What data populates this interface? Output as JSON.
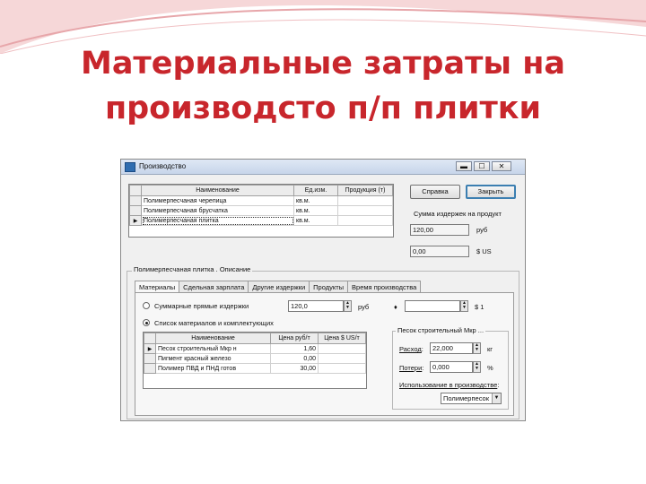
{
  "slide": {
    "title_line1": "Материальные затраты на",
    "title_line2": "производсто п/п плитки",
    "accent": "#c8262c"
  },
  "window": {
    "title": "Производство",
    "controls": {
      "minimize": "▬",
      "maximize": "☐",
      "close": "✕"
    }
  },
  "products_grid": {
    "columns": [
      "Наименование",
      "Ед.изм.",
      "Продукция (т)"
    ],
    "rows": [
      {
        "indicator": "",
        "name": "Полимерпесчаная черепица",
        "unit": "кв.м.",
        "qty": ""
      },
      {
        "indicator": "",
        "name": "Полимерпесчаная брусчатка",
        "unit": "кв.м.",
        "qty": ""
      },
      {
        "indicator": "▶",
        "name": "Полимерпесчаная плитка",
        "unit": "кв.м.",
        "qty": ""
      }
    ]
  },
  "right_panel": {
    "help_button": "Справка",
    "close_button": "Закрыть",
    "total_cost_label": "Сумма издержек на продукт",
    "cost_rub": "120,00",
    "rub_unit": "руб",
    "cost_usd": "0,00",
    "usd_unit": "$ US"
  },
  "details_group": {
    "title": "Полимерпесчаная плитка . Описание",
    "tabs": [
      "Материалы",
      "Сдельная зарплата",
      "Другие издержки",
      "Продукты",
      "Время производства"
    ],
    "active_tab": 0
  },
  "materials_tab": {
    "radio_total": "Суммарные прямые издержки",
    "total_value": "120,0",
    "total_unit": "руб",
    "usd_value": "",
    "usd_unit": "$ 1",
    "radio_list": "Список материалов и комплектующих",
    "grid": {
      "columns": [
        "Наименование",
        "Цена руб/т",
        "Цена $ US/т"
      ],
      "rows": [
        {
          "indicator": "▶",
          "name": "Песок строительный Мкр н",
          "price_rub": "1,60",
          "price_usd": ""
        },
        {
          "indicator": "",
          "name": "Пигмент красный железо",
          "price_rub": "0,00",
          "price_usd": ""
        },
        {
          "indicator": "",
          "name": "Полимер ПВД и ПНД готов",
          "price_rub": "30,00",
          "price_usd": ""
        }
      ]
    }
  },
  "consumption_group": {
    "title": "Песок строительный Мкр ...",
    "rate_label": "Расход",
    "rate_value": "22,000",
    "rate_unit": "кг",
    "loss_label": "Потери",
    "loss_value": "0,000",
    "loss_unit": "%",
    "usage_label": "Использование в производстве",
    "usage_value": "Полимерпесок"
  }
}
